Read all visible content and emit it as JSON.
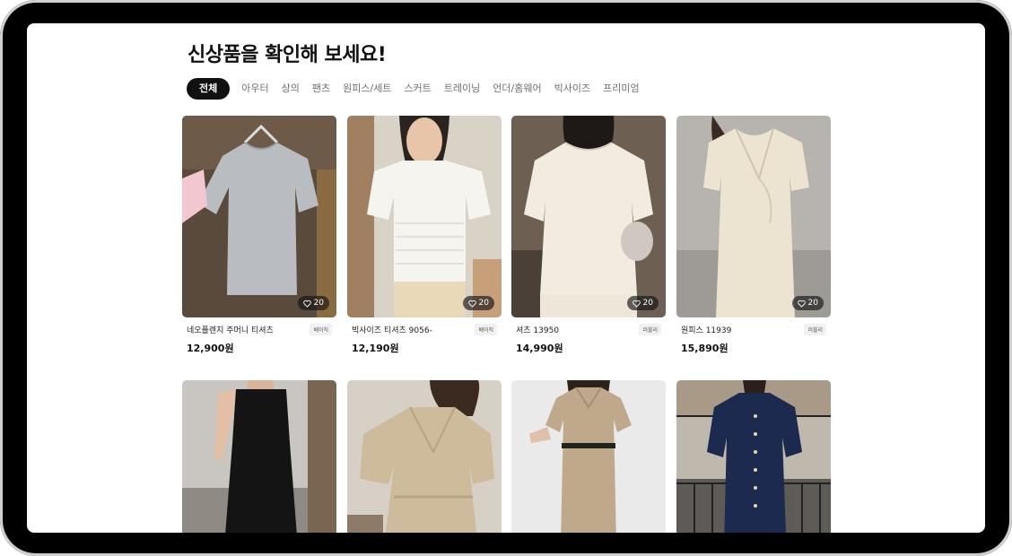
{
  "page": {
    "title": "신상품을 확인해 보세요!"
  },
  "tabs": [
    {
      "label": "전체",
      "active": true
    },
    {
      "label": "아우터"
    },
    {
      "label": "상의"
    },
    {
      "label": "팬츠"
    },
    {
      "label": "원피스/세트"
    },
    {
      "label": "스커트"
    },
    {
      "label": "트레이닝"
    },
    {
      "label": "언더/홈웨어"
    },
    {
      "label": "빅사이즈"
    },
    {
      "label": "프리미엄"
    }
  ],
  "products": [
    {
      "name": "네오플렌지 주머니 티셔츠",
      "tag": "베이직",
      "price": "12,900원",
      "likes": "20",
      "image": "gray-tshirt"
    },
    {
      "name": "빅사이즈 티셔츠 9056-",
      "tag": "베이직",
      "price": "12,190원",
      "likes": "20",
      "image": "white-lace-top"
    },
    {
      "name": "셔츠 13950",
      "tag": "러블리",
      "price": "14,990원",
      "likes": "20",
      "image": "cream-blouse"
    },
    {
      "name": "원피스 11939",
      "tag": "러블리",
      "price": "15,890원",
      "likes": "20",
      "image": "beige-wrap-dress"
    },
    {
      "image": "black-sleeveless-dress"
    },
    {
      "image": "beige-tie-dress"
    },
    {
      "image": "khaki-belted-shirt-dress"
    },
    {
      "image": "navy-button-dress"
    }
  ],
  "colors": {
    "accent": "#111111",
    "muted_text": "#6f6f6f",
    "tag_bg": "#f1f1f1"
  }
}
